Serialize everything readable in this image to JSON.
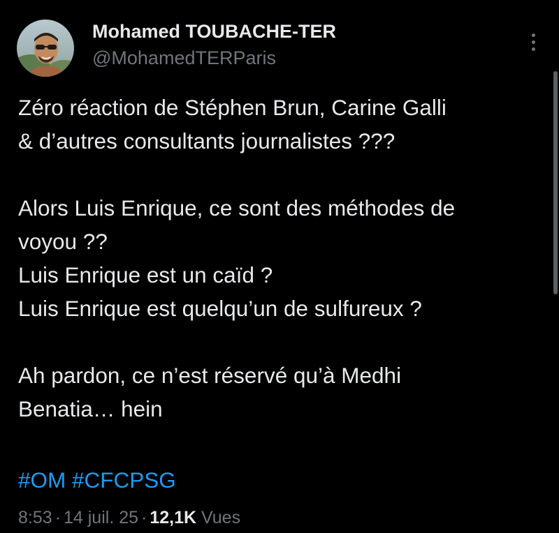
{
  "author": {
    "display_name": "Mohamed TOUBACHE-TER",
    "handle": "@MohamedTERParis",
    "avatar": "profile-photo"
  },
  "tweet": {
    "lines": [
      "Zéro réaction de Stéphen Brun, Carine Galli",
      "& d’autres consultants journalistes ???",
      "",
      "Alors Luis Enrique, ce sont des méthodes de",
      "voyou ??",
      "Luis Enrique est un caïd ?",
      "Luis Enrique est quelqu’un de sulfureux ?",
      "",
      "Ah pardon, ce n’est réservé qu’à Medhi",
      "Benatia… hein"
    ],
    "hashtags": [
      "#OM",
      "#CFCPSG"
    ]
  },
  "meta": {
    "time": "8:53",
    "separator": "·",
    "date": "14 juil. 25",
    "views_count": "12,1K",
    "views_label": "Vues"
  },
  "icons": {
    "more": "more-vertical-icon"
  },
  "colors": {
    "background": "#000000",
    "text": "#e7e9ea",
    "secondary": "#71767b",
    "link": "#1d9bf0"
  }
}
